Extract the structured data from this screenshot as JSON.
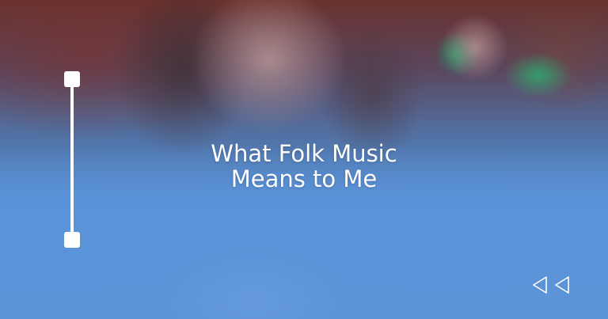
{
  "hero": {
    "title_line1": "What Folk Music",
    "title_line2": "Means to Me"
  },
  "icons": {
    "nav_prev": "triangle-left-icon",
    "nav_next": "triangle-left-icon"
  },
  "colors": {
    "background": "#5b92d6",
    "foreground": "#ffffff"
  }
}
